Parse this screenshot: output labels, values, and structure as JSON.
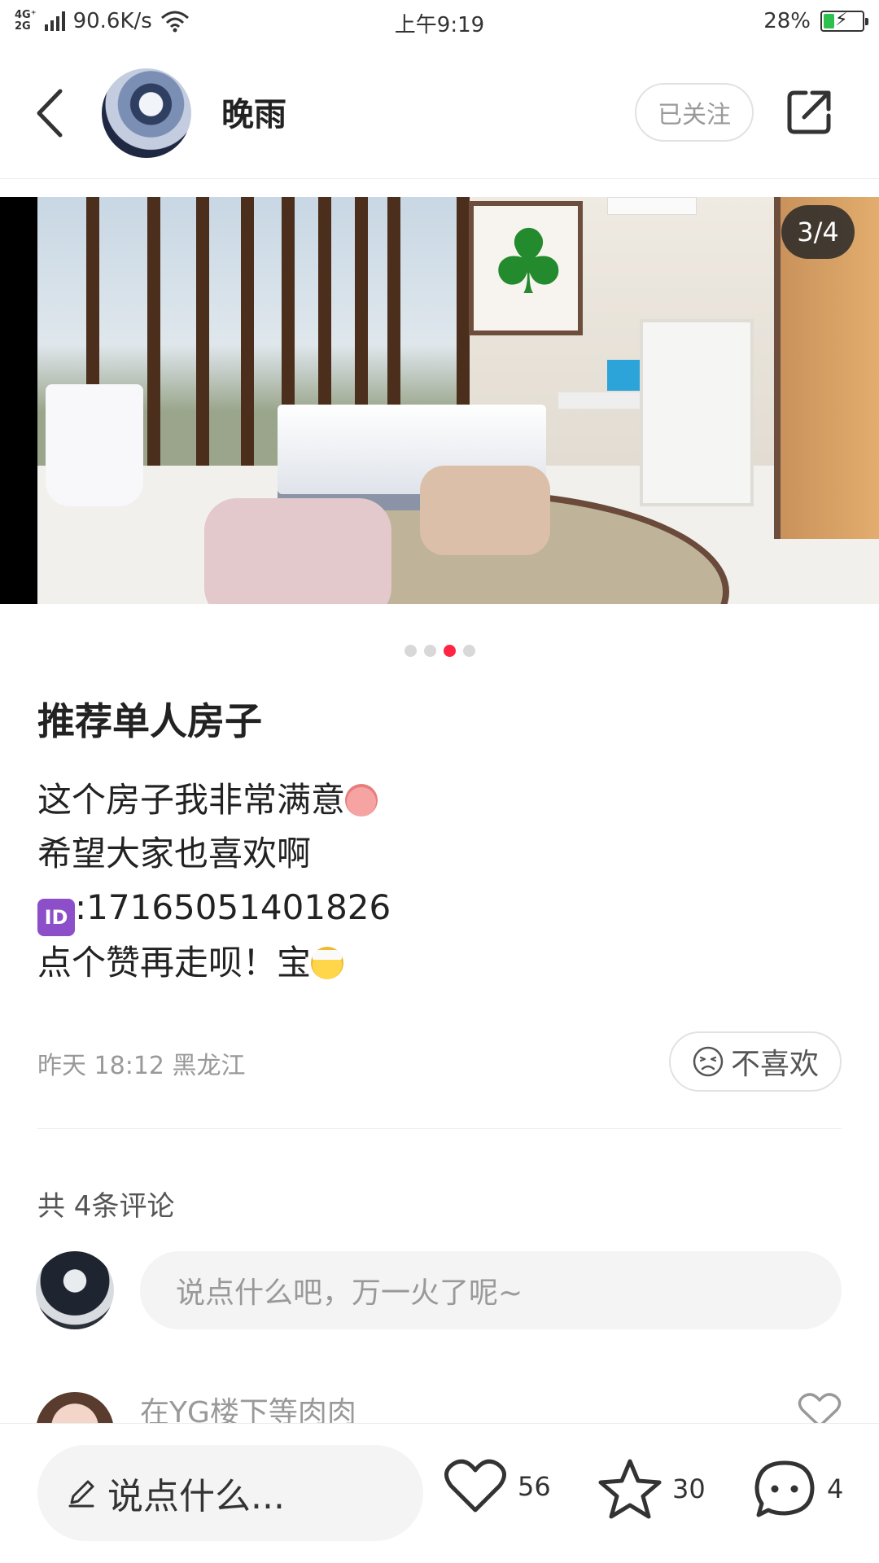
{
  "status_bar": {
    "net_top": "4G⁺",
    "net_bottom": "2G",
    "speed": "90.6K/s",
    "time": "上午9:19",
    "battery": "28%",
    "battery_level": 0.28,
    "battery_color": "#2ec04f"
  },
  "header": {
    "back_icon": "chevron-left-icon",
    "user_name": "晚雨",
    "follow_label": "已关注",
    "share_icon": "share-icon"
  },
  "carousel": {
    "counter": "3/4",
    "current": 3,
    "total": 4,
    "active_dot_color": "#ff2442"
  },
  "post": {
    "title": "推荐单人房子",
    "lines": [
      "这个房子我非常满意",
      "希望大家也喜欢啊",
      ":17165051401826",
      "点个赞再走呗！宝"
    ],
    "id_badge": "ID",
    "meta": "昨天 18:12 黑龙江",
    "dislike_label": "不喜欢"
  },
  "comments": {
    "count_label": "共 4条评论",
    "input_placeholder": "说点什么吧，万一火了呢~",
    "items": [
      {
        "user": "在YG楼下等肉肉"
      }
    ]
  },
  "bottom_bar": {
    "input_placeholder": "说点什么...",
    "likes": "56",
    "favorites": "30",
    "comments": "4"
  }
}
